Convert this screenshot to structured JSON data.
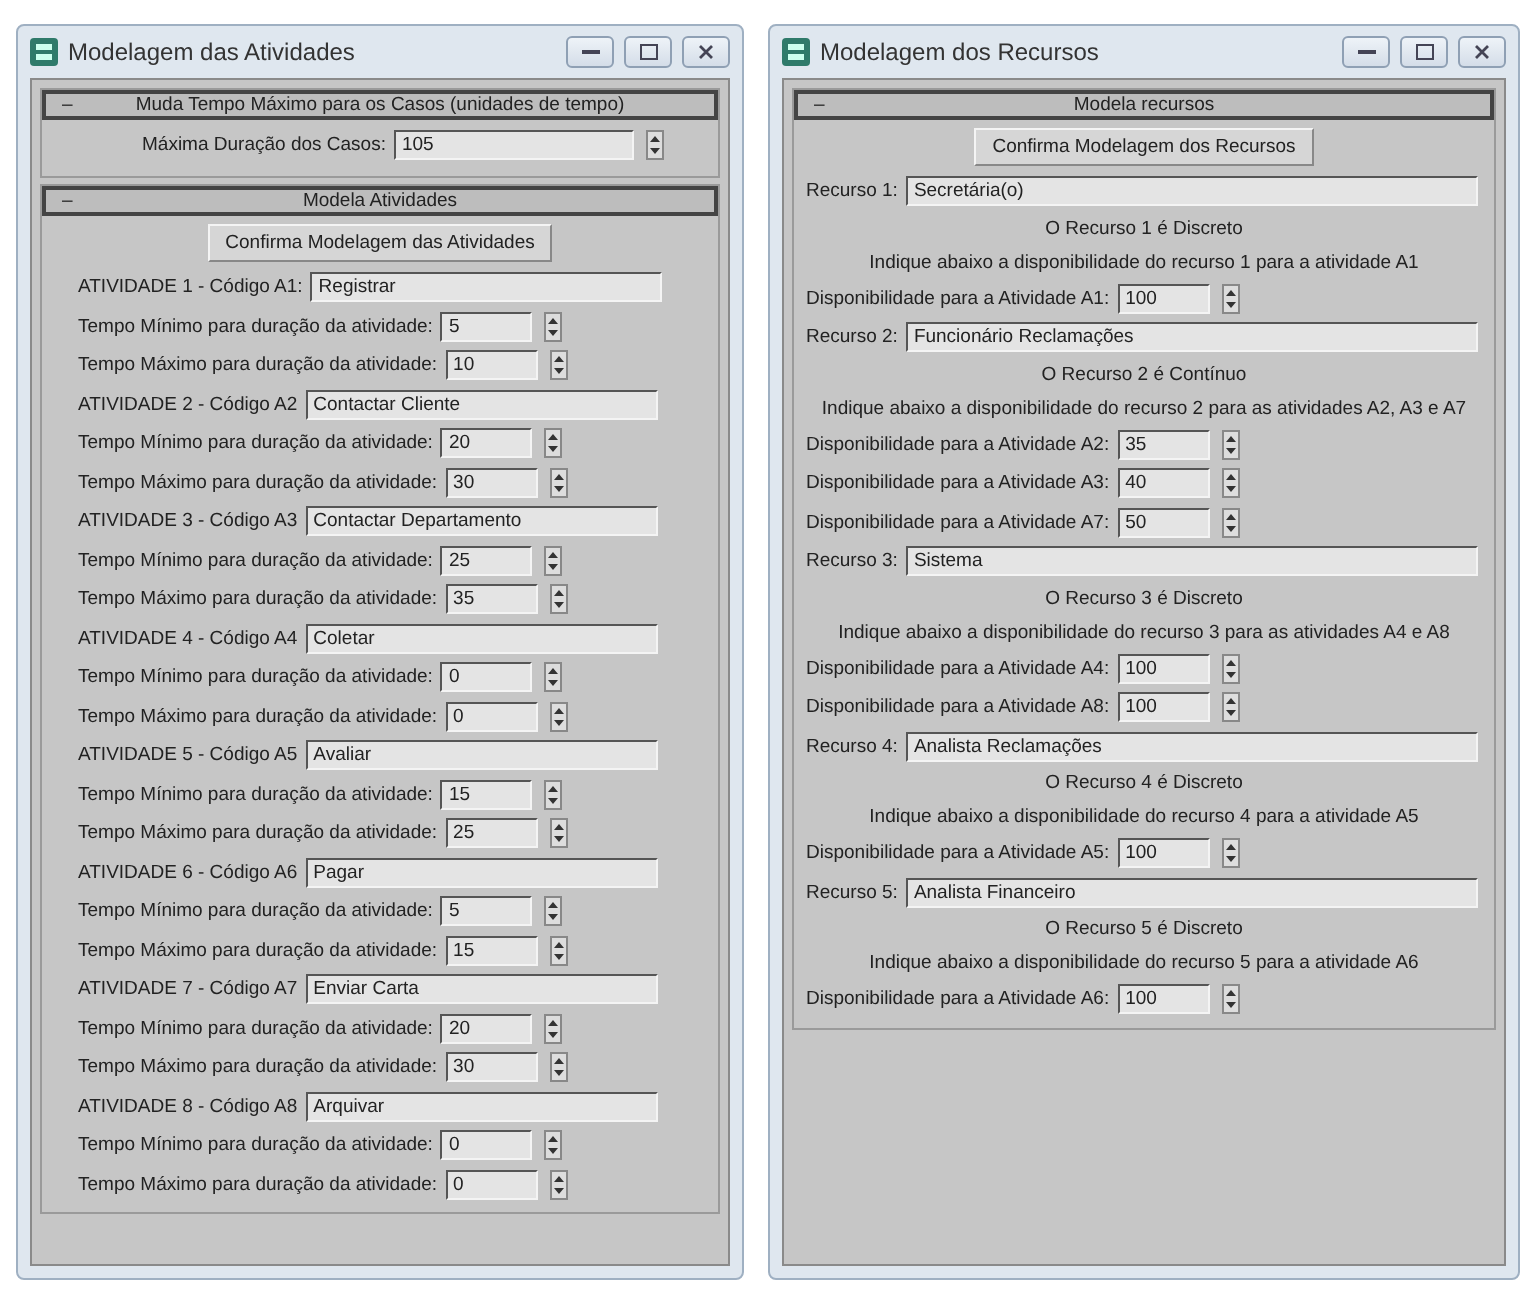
{
  "activities_window": {
    "title": "Modelagem das Atividades",
    "time_rollout": {
      "header": "Muda Tempo Máximo para os Casos (unidades de tempo)",
      "expander": "–",
      "label": "Máxima Duração dos Casos:",
      "value": "105"
    },
    "activities_rollout": {
      "header": "Modela Atividades",
      "expander": "–",
      "button": "Confirma Modelagem das Atividades",
      "activities": [
        {
          "label": "ATIVIDADE 1 - Código A1:",
          "name": "Registrar",
          "min_label": "Tempo Mínimo para duração da atividade:",
          "min": "5",
          "max_label": "Tempo Máximo para duração da atividade:",
          "max": "10"
        },
        {
          "label": "ATIVIDADE 2 - Código A2",
          "name": "Contactar Cliente",
          "min_label": "Tempo Mínimo para duração da atividade:",
          "min": "20",
          "max_label": "Tempo Máximo para duração da atividade:",
          "max": "30"
        },
        {
          "label": "ATIVIDADE 3 - Código A3",
          "name": "Contactar Departamento",
          "min_label": "Tempo Mínimo para duração da atividade:",
          "min": "25",
          "max_label": "Tempo Máximo para duração da atividade:",
          "max": "35"
        },
        {
          "label": "ATIVIDADE 4 - Código A4",
          "name": "Coletar",
          "min_label": "Tempo Mínimo para duração da atividade:",
          "min": "0",
          "max_label": "Tempo Máximo para duração da atividade:",
          "max": "0"
        },
        {
          "label": "ATIVIDADE 5 - Código A5",
          "name": "Avaliar",
          "min_label": "Tempo Mínimo para duração da atividade:",
          "min": "15",
          "max_label": "Tempo Máximo para duração da atividade:",
          "max": "25"
        },
        {
          "label": "ATIVIDADE 6 - Código A6",
          "name": "Pagar",
          "min_label": "Tempo Mínimo para duração da atividade:",
          "min": "5",
          "max_label": "Tempo Máximo para duração da atividade:",
          "max": "15"
        },
        {
          "label": "ATIVIDADE 7 - Código A7",
          "name": "Enviar Carta",
          "min_label": "Tempo Mínimo para duração da atividade:",
          "min": "20",
          "max_label": "Tempo Máximo para duração da atividade:",
          "max": "30"
        },
        {
          "label": "ATIVIDADE 8 - Código A8",
          "name": "Arquivar",
          "min_label": "Tempo Mínimo para duração da atividade:",
          "min": "0",
          "max_label": "Tempo Máximo para duração da atividade:",
          "max": "0"
        }
      ]
    }
  },
  "resources_window": {
    "title": "Modelagem dos Recursos",
    "resources_rollout": {
      "header": "Modela recursos",
      "expander": "–",
      "button": "Confirma Modelagem dos Recursos",
      "resources": [
        {
          "label": "Recurso 1:",
          "name": "Secretária(o)",
          "status": "O Recurso 1 é Discreto",
          "instruction": "Indique abaixo a disponibilidade do recurso 1 para a atividade A1",
          "availability": [
            {
              "label": "Disponibilidade para a Atividade A1:",
              "value": "100"
            }
          ]
        },
        {
          "label": "Recurso 2:",
          "name": "Funcionário Reclamações",
          "status": "O Recurso 2 é Contínuo",
          "instruction": "Indique abaixo a disponibilidade do recurso 2 para as atividades A2, A3 e A7",
          "availability": [
            {
              "label": "Disponibilidade para a Atividade A2:",
              "value": "35"
            },
            {
              "label": "Disponibilidade para a Atividade A3:",
              "value": "40"
            },
            {
              "label": "Disponibilidade para a Atividade A7:",
              "value": "50"
            }
          ]
        },
        {
          "label": "Recurso 3:",
          "name": "Sistema",
          "status": "O Recurso 3 é Discreto",
          "instruction": "Indique abaixo a disponibilidade do recurso 3 para as atividades A4 e A8",
          "availability": [
            {
              "label": "Disponibilidade para a Atividade A4:",
              "value": "100"
            },
            {
              "label": "Disponibilidade para a Atividade A8:",
              "value": "100"
            }
          ]
        },
        {
          "label": "Recurso 4:",
          "name": "Analista Reclamações",
          "status": "O Recurso 4 é Discreto",
          "instruction": "Indique abaixo a disponibilidade do recurso 4 para a atividade A5",
          "availability": [
            {
              "label": "Disponibilidade para a Atividade A5:",
              "value": "100"
            }
          ]
        },
        {
          "label": "Recurso 5:",
          "name": "Analista Financeiro",
          "status": "O Recurso 5 é Discreto",
          "instruction": "Indique abaixo a disponibilidade do recurso 5 para a atividade A6",
          "availability": [
            {
              "label": "Disponibilidade para a Atividade A6:",
              "value": "100"
            }
          ]
        }
      ]
    }
  }
}
